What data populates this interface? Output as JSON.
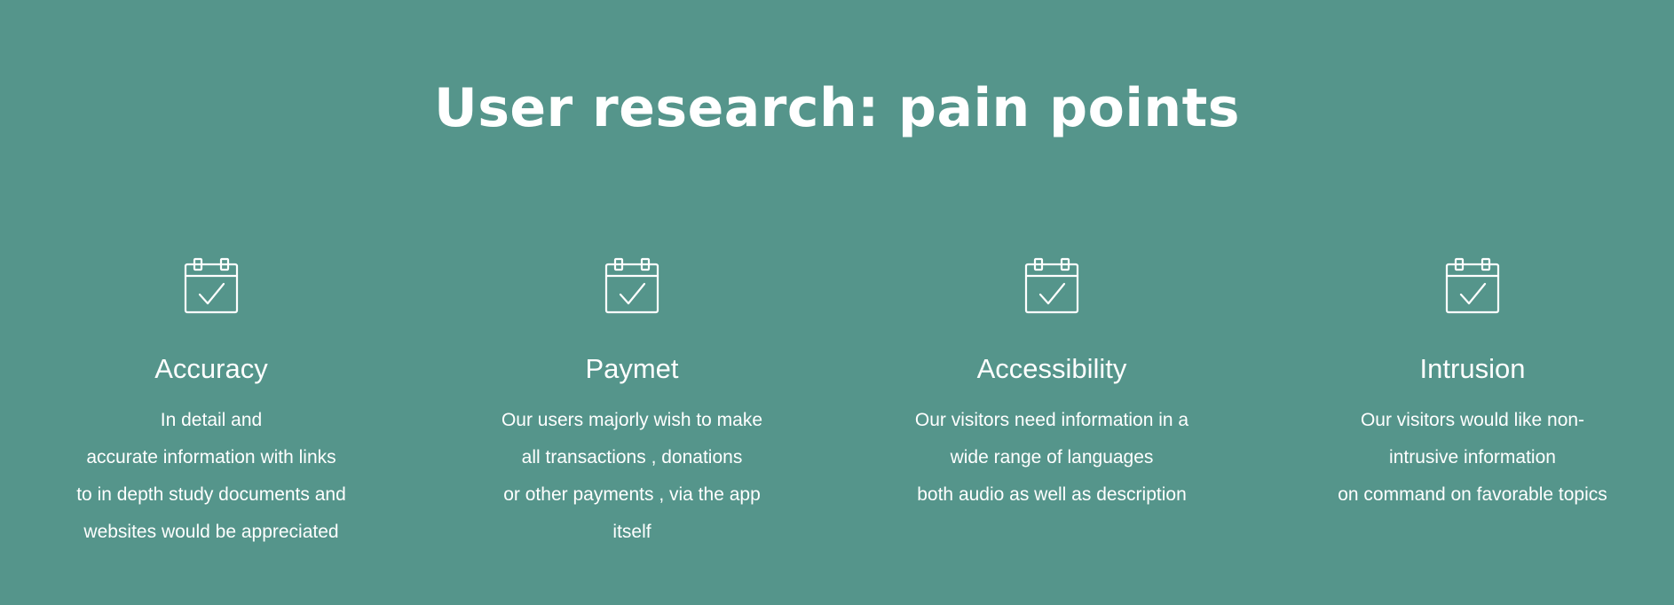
{
  "page": {
    "title": "User research: pain points",
    "background_color": "#55958b",
    "text_color": "#ffffff"
  },
  "cards": [
    {
      "icon": "calendar-check-icon",
      "title": "Accuracy",
      "lines": [
        "In detail and",
        "accurate information with links",
        "to in depth study documents and",
        "websites would be appreciated"
      ]
    },
    {
      "icon": "calendar-check-icon",
      "title": "Paymet",
      "lines": [
        "Our users majorly wish to make",
        "all transactions , donations",
        "or other payments , via the app",
        "itself"
      ]
    },
    {
      "icon": "calendar-check-icon",
      "title": "Accessibility",
      "lines": [
        "Our visitors need information in a",
        "wide range of languages",
        "both audio as well as description"
      ]
    },
    {
      "icon": "calendar-check-icon",
      "title": "Intrusion",
      "lines": [
        "Our visitors would like non-",
        "intrusive information",
        "on command on favorable topics"
      ]
    }
  ]
}
